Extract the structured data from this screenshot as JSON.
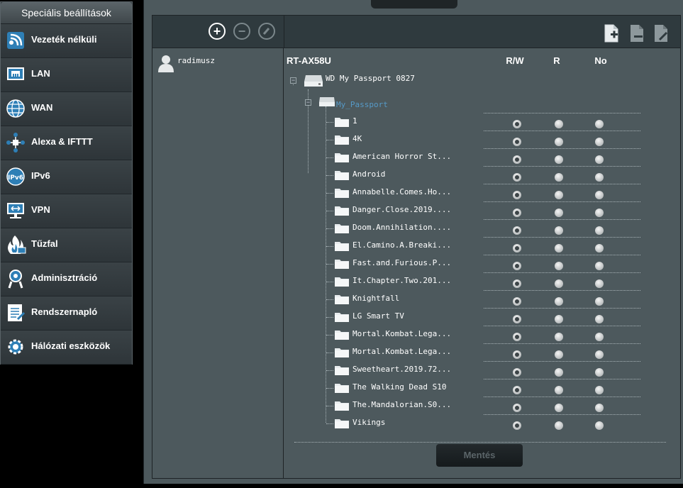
{
  "sidebar": {
    "title": "Speciális beállítások",
    "items": [
      {
        "label": "Vezeték nélküli",
        "icon": "wireless-icon"
      },
      {
        "label": "LAN",
        "icon": "lan-icon"
      },
      {
        "label": "WAN",
        "icon": "wan-globe-icon"
      },
      {
        "label": "Alexa & IFTTT",
        "icon": "alexa-ifttt-icon"
      },
      {
        "label": "IPv6",
        "icon": "ipv6-icon"
      },
      {
        "label": "VPN",
        "icon": "vpn-icon"
      },
      {
        "label": "Tűzfal",
        "icon": "firewall-icon"
      },
      {
        "label": "Adminisztráció",
        "icon": "administration-icon"
      },
      {
        "label": "Rendszernapló",
        "icon": "system-log-icon"
      },
      {
        "label": "Hálózati eszközök",
        "icon": "network-tools-icon"
      }
    ]
  },
  "user": {
    "name": "radimusz"
  },
  "tree": {
    "router": "RT-AX58U",
    "drive": "WD My Passport 0827",
    "partition": "My_Passport",
    "columns": [
      "R/W",
      "R",
      "No"
    ],
    "folders": [
      {
        "name": "1",
        "perm": "R/W"
      },
      {
        "name": "4K",
        "perm": "R/W"
      },
      {
        "name": "American Horror St...",
        "perm": "R/W"
      },
      {
        "name": "Android",
        "perm": "R/W"
      },
      {
        "name": "Annabelle.Comes.Ho...",
        "perm": "R/W"
      },
      {
        "name": "Danger.Close.2019....",
        "perm": "R/W"
      },
      {
        "name": "Doom.Annihilation....",
        "perm": "R/W"
      },
      {
        "name": "El.Camino.A.Breaki...",
        "perm": "R/W"
      },
      {
        "name": "Fast.and.Furious.P...",
        "perm": "R/W"
      },
      {
        "name": "It.Chapter.Two.201...",
        "perm": "R/W"
      },
      {
        "name": "Knightfall",
        "perm": "R/W"
      },
      {
        "name": "LG Smart TV",
        "perm": "R/W"
      },
      {
        "name": "Mortal.Kombat.Lega...",
        "perm": "R/W"
      },
      {
        "name": "Mortal.Kombat.Lega...",
        "perm": "R/W"
      },
      {
        "name": "Sweetheart.2019.72...",
        "perm": "R/W"
      },
      {
        "name": "The Walking Dead S10",
        "perm": "R/W"
      },
      {
        "name": "The.Mandalorian.S0...",
        "perm": "R/W"
      },
      {
        "name": "Vikings",
        "perm": "R/W"
      }
    ]
  },
  "buttons": {
    "save": "Mentés"
  },
  "colors": {
    "accent_blue": "#569ac7",
    "panel": "#4d595d",
    "sidebar": "#363d41"
  }
}
